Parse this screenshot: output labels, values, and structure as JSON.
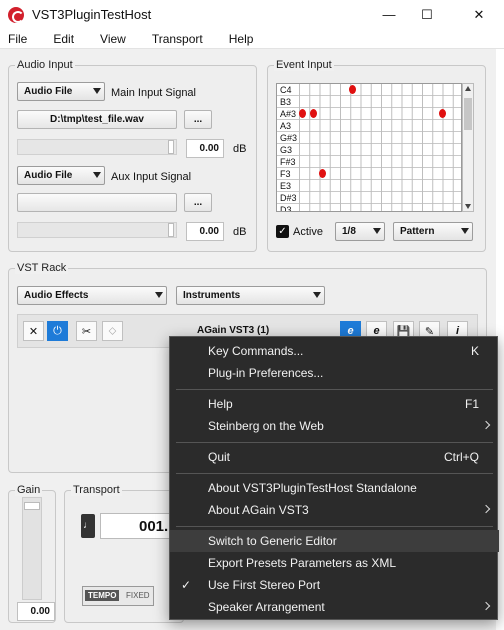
{
  "window": {
    "title": "VST3PluginTestHost",
    "minimize": "—",
    "maximize": "☐",
    "close": "✕"
  },
  "menu": [
    "File",
    "Edit",
    "View",
    "Transport",
    "Help"
  ],
  "audio_input": {
    "title": "Audio Input",
    "main_source": "Audio File",
    "main_label": "Main Input Signal",
    "main_file": "D:\\tmp\\test_file.wav",
    "browse": "...",
    "main_value": "0.00",
    "main_unit": "dB",
    "aux_source": "Audio File",
    "aux_label": "Aux Input Signal",
    "aux_file": "",
    "aux_browse": "...",
    "aux_value": "0.00",
    "aux_unit": "dB"
  },
  "event_input": {
    "title": "Event Input",
    "notes": [
      "C4",
      "B3",
      "A#3",
      "A3",
      "G#3",
      "G3",
      "F#3",
      "F3",
      "E3",
      "D#3",
      "D3"
    ],
    "active_label": "Active",
    "active": true,
    "division": "1/8",
    "mode": "Pattern"
  },
  "vst_rack": {
    "title": "VST Rack",
    "category": "Audio Effects",
    "instruments": "Instruments",
    "plugin_name": "AGain VST3 (1)",
    "buttons": [
      "✕",
      "⏻",
      "✂",
      "⬦",
      "e",
      "e",
      "💾",
      "✎",
      "i"
    ]
  },
  "gain": {
    "title": "Gain",
    "value": "0.00"
  },
  "transport": {
    "title": "Transport",
    "position": "001.",
    "tempo": "TEMPO",
    "tempo_mode": "FIXED"
  },
  "context_menu": {
    "items": [
      {
        "label": "Key Commands...",
        "shortcut": "K"
      },
      {
        "label": "Plug-in Preferences...",
        "shortcut": ""
      },
      {
        "label": "Help",
        "shortcut": "F1"
      },
      {
        "label": "Steinberg on the Web",
        "shortcut": ""
      },
      {
        "label": "Quit",
        "shortcut": "Ctrl+Q"
      },
      {
        "label": "About VST3PluginTestHost Standalone",
        "shortcut": ""
      },
      {
        "label": "About AGain VST3",
        "shortcut": ""
      },
      {
        "label": "Switch to Generic Editor",
        "shortcut": ""
      },
      {
        "label": "Export Presets Parameters as XML",
        "shortcut": ""
      },
      {
        "label": "Use First Stereo Port",
        "shortcut": "",
        "checked": true
      },
      {
        "label": "Speaker Arrangement",
        "shortcut": ""
      }
    ]
  }
}
